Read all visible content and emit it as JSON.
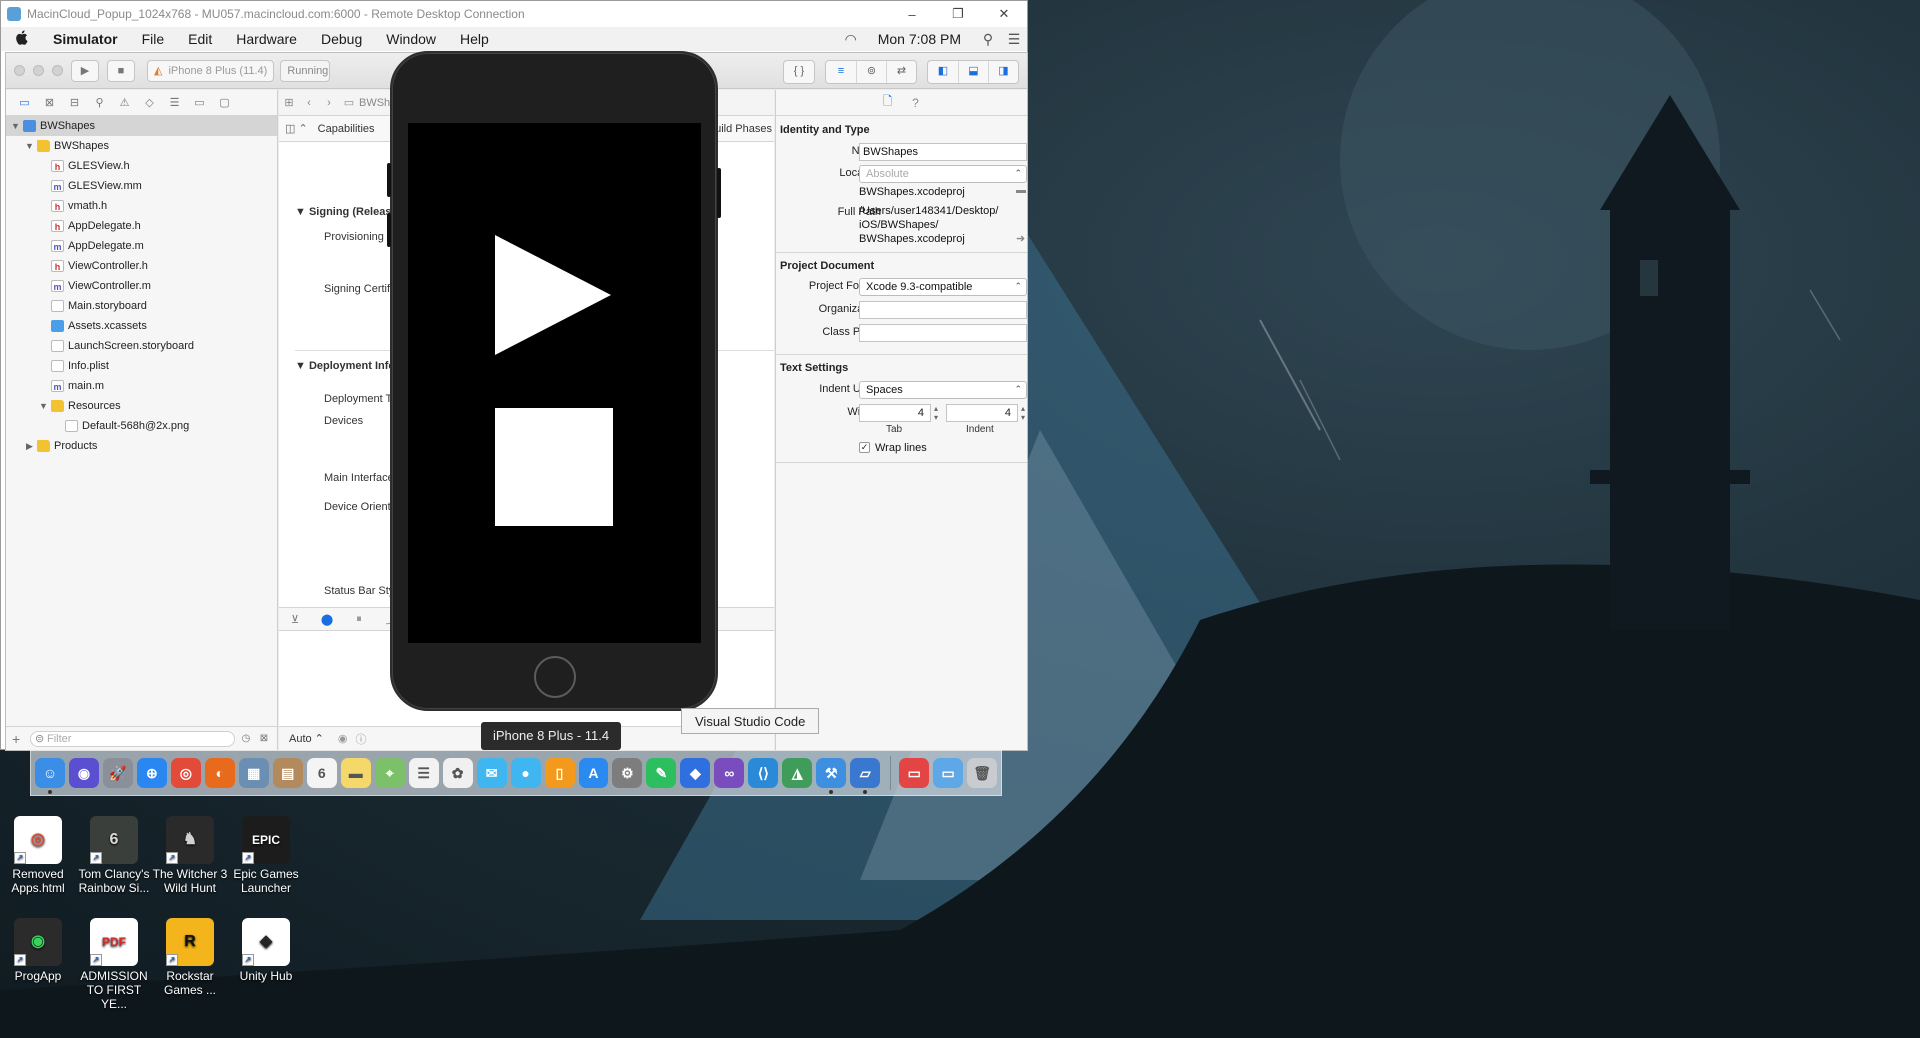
{
  "rdp": {
    "title": "MacinCloud_Popup_1024x768 - MU057.macincloud.com:6000 - Remote Desktop Connection",
    "minimize": "–",
    "restore": "❐",
    "close": "✕"
  },
  "menubar": {
    "apple": "",
    "items": [
      "Simulator",
      "File",
      "Edit",
      "Hardware",
      "Debug",
      "Window",
      "Help"
    ],
    "clock": "Mon 7:08 PM",
    "wifi": "◠",
    "search": "⚲",
    "list": "☰"
  },
  "toolbar": {
    "run": "▶",
    "stop": "■",
    "scheme_device": "iPhone 8 Plus (11.4)",
    "status": "Running BWShapes",
    "editor_modes": [
      "≡",
      "⊚",
      "⇄"
    ],
    "panels": [
      "◧",
      "⬓",
      "◨"
    ],
    "brace": "{ }"
  },
  "navigator": {
    "tabs": [
      "▭",
      "⊠",
      "⊟",
      "⚲",
      "⚠",
      "◇",
      "☰",
      "▭",
      "▢"
    ],
    "rows": [
      {
        "label": "BWShapes",
        "level": 0,
        "icon": "proj",
        "open": true,
        "glyph": ""
      },
      {
        "label": "BWShapes",
        "level": 1,
        "icon": "folder",
        "open": true,
        "glyph": ""
      },
      {
        "label": "GLESView.h",
        "level": 2,
        "icon": "h",
        "glyph": "h"
      },
      {
        "label": "GLESView.mm",
        "level": 2,
        "icon": "m",
        "glyph": "m"
      },
      {
        "label": "vmath.h",
        "level": 2,
        "icon": "h",
        "glyph": "h"
      },
      {
        "label": "AppDelegate.h",
        "level": 2,
        "icon": "h",
        "glyph": "h"
      },
      {
        "label": "AppDelegate.m",
        "level": 2,
        "icon": "m",
        "glyph": "m"
      },
      {
        "label": "ViewController.h",
        "level": 2,
        "icon": "h",
        "glyph": "h"
      },
      {
        "label": "ViewController.m",
        "level": 2,
        "icon": "m",
        "glyph": "m"
      },
      {
        "label": "Main.storyboard",
        "level": 2,
        "icon": "sb",
        "glyph": ""
      },
      {
        "label": "Assets.xcassets",
        "level": 2,
        "icon": "xcassets",
        "glyph": ""
      },
      {
        "label": "LaunchScreen.storyboard",
        "level": 2,
        "icon": "sb",
        "glyph": ""
      },
      {
        "label": "Info.plist",
        "level": 2,
        "icon": "plist",
        "glyph": ""
      },
      {
        "label": "main.m",
        "level": 2,
        "icon": "m",
        "glyph": "m"
      },
      {
        "label": "Resources",
        "level": 2,
        "icon": "folder",
        "open": true,
        "glyph": ""
      },
      {
        "label": "Default-568h@2x.png",
        "level": 3,
        "icon": "png",
        "glyph": ""
      },
      {
        "label": "Products",
        "level": 1,
        "icon": "folder",
        "open": false,
        "glyph": ""
      }
    ],
    "filter_placeholder": "Filter",
    "add": "+"
  },
  "editor": {
    "jump": [
      "⊞",
      "‹",
      "›",
      "▭",
      "BWShapes"
    ],
    "tab_capabilities": "Capabilities",
    "tab_build_phases": "Build Phases",
    "signing_header": "Signing (Release)",
    "provisioning": "Provisioning Profile",
    "signing_cert": "Signing Certificate",
    "deployment_header": "Deployment Info",
    "deployment_target": "Deployment Target",
    "devices": "Devices",
    "main_interface": "Main Interface",
    "device_orientation": "Device Orientation",
    "status_bar": "Status Bar Style",
    "auto": "Auto ⌃",
    "debug_icons": [
      "⊻",
      "⬤",
      "⏸",
      "⤴"
    ]
  },
  "inspector": {
    "tabs": [
      "🗋",
      "?"
    ],
    "identity_header": "Identity and Type",
    "name_label": "Name",
    "name_value": "BWShapes",
    "location_label": "Location",
    "location_value": "Absolute",
    "filename": "BWShapes.xcodeproj",
    "full_path_label": "Full Path",
    "full_path_lines": [
      "/Users/user148341/Desktop/",
      "iOS/BWShapes/",
      "BWShapes.xcodeproj"
    ],
    "project_doc_header": "Project Document",
    "project_format_label": "Project Format",
    "project_format_value": "Xcode 9.3-compatible",
    "organization_label": "Organization",
    "organization_value": "",
    "class_prefix_label": "Class Prefix",
    "class_prefix_value": "",
    "text_settings_header": "Text Settings",
    "indent_using_label": "Indent Using",
    "indent_using_value": "Spaces",
    "widths_label": "Widths",
    "tab_width": "4",
    "indent_width": "4",
    "tab_caption": "Tab",
    "indent_caption": "Indent",
    "wrap_lines_label": "Wrap lines",
    "wrap_lines_checked": true
  },
  "simulator": {
    "device_tooltip": "iPhone 8 Plus - 11.4"
  },
  "tooltip_vscode": "Visual Studio Code",
  "dock": [
    {
      "name": "finder",
      "glyph": "☺",
      "color": "#3a8ee6",
      "running": true
    },
    {
      "name": "siri",
      "glyph": "◉",
      "color": "#5a4fd0",
      "running": false
    },
    {
      "name": "launchpad",
      "glyph": "🚀",
      "color": "#8a8f99",
      "running": false
    },
    {
      "name": "safari",
      "glyph": "⊕",
      "color": "#2a86f0",
      "running": false
    },
    {
      "name": "chrome",
      "glyph": "◎",
      "color": "#e24b3a",
      "running": false
    },
    {
      "name": "firefox",
      "glyph": "◐",
      "color": "#e86a1c",
      "running": false
    },
    {
      "name": "preview",
      "glyph": "▦",
      "color": "#6b8fb2",
      "running": false
    },
    {
      "name": "contacts",
      "glyph": "▤",
      "color": "#b38a5c",
      "running": false
    },
    {
      "name": "calendar",
      "glyph": "6",
      "color": "#f4f4f4",
      "running": false
    },
    {
      "name": "notes",
      "glyph": "▬",
      "color": "#f5d86a",
      "running": false
    },
    {
      "name": "maps",
      "glyph": "⌖",
      "color": "#7cc06a",
      "running": false
    },
    {
      "name": "reminders",
      "glyph": "☰",
      "color": "#f2f2f2",
      "running": false
    },
    {
      "name": "photos",
      "glyph": "✿",
      "color": "#f0f0f0",
      "running": false
    },
    {
      "name": "messages",
      "glyph": "✉",
      "color": "#3fb6f0",
      "running": false
    },
    {
      "name": "facetime",
      "glyph": "●",
      "color": "#3fb6f0",
      "running": false
    },
    {
      "name": "ibooks",
      "glyph": "▯",
      "color": "#f39a1c",
      "running": false
    },
    {
      "name": "appstore",
      "glyph": "A",
      "color": "#2a8af0",
      "running": false
    },
    {
      "name": "system-preferences",
      "glyph": "⚙",
      "color": "#7d7d7d",
      "running": false
    },
    {
      "name": "evernote",
      "glyph": "✎",
      "color": "#2dbe60",
      "running": false
    },
    {
      "name": "dropbox",
      "glyph": "◆",
      "color": "#2f6fe0",
      "running": false
    },
    {
      "name": "visual-studio",
      "glyph": "∞",
      "color": "#7a4dbf",
      "running": false
    },
    {
      "name": "vscode",
      "glyph": "⟨⟩",
      "color": "#2a8ad8",
      "running": false
    },
    {
      "name": "android-studio",
      "glyph": "◮",
      "color": "#3f9c5a",
      "running": false
    },
    {
      "name": "xcode",
      "glyph": "⚒",
      "color": "#3f8fe0",
      "running": true
    },
    {
      "name": "simulator",
      "glyph": "▱",
      "color": "#3a78d0",
      "running": true
    }
  ],
  "dock_right": [
    {
      "name": "downloads-stack",
      "glyph": "▭",
      "color": "#e34545"
    },
    {
      "name": "documents-folder",
      "glyph": "▭",
      "color": "#5fa8e8"
    },
    {
      "name": "trash",
      "glyph": "🗑",
      "color": "#c8ccd0"
    }
  ],
  "desktop_icons": [
    {
      "name": "removed-apps",
      "label1": "Removed",
      "label2": "Apps.html",
      "glyph": "◎",
      "bg": "#ffffff",
      "fg": "#dd4b39"
    },
    {
      "name": "rainbow-six",
      "label1": "Tom Clancy's",
      "label2": "Rainbow Si...",
      "glyph": "6",
      "bg": "#3a3f3b",
      "fg": "#d8d8d8"
    },
    {
      "name": "witcher-3",
      "label1": "The Witcher 3",
      "label2": "Wild Hunt",
      "glyph": "♞",
      "bg": "#2a2a2a",
      "fg": "#d0d0d0"
    },
    {
      "name": "epic-games",
      "label1": "Epic Games",
      "label2": "Launcher",
      "glyph": "EPIC",
      "bg": "#1c1c1c",
      "fg": "#ffffff"
    },
    {
      "name": "progapp",
      "label1": "ProgApp",
      "label2": "",
      "glyph": "◉",
      "bg": "#2b2b2b",
      "fg": "#3cd060"
    },
    {
      "name": "admission-pdf",
      "label1": "ADMISSION",
      "label2": "TO FIRST YE...",
      "glyph": "PDF",
      "bg": "#ffffff",
      "fg": "#d22a2a"
    },
    {
      "name": "rockstar-games",
      "label1": "Rockstar",
      "label2": "Games ...",
      "glyph": "R",
      "bg": "#f3b51b",
      "fg": "#111111"
    },
    {
      "name": "unity-hub",
      "label1": "Unity Hub",
      "label2": "",
      "glyph": "◈",
      "bg": "#ffffff",
      "fg": "#222222"
    }
  ]
}
